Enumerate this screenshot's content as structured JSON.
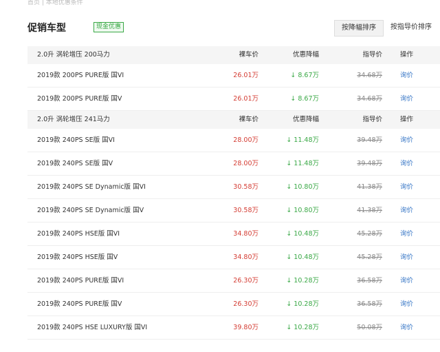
{
  "top_note": "首页 | 本地优惠条件",
  "header": {
    "title": "促销车型",
    "badge": "现金优惠",
    "sort_cut_label": "按降幅排序",
    "sort_guide_label": "按指导价排序"
  },
  "groups": [
    {
      "engine": "2.0升 涡轮增压 200马力",
      "columns": {
        "price": "裸车价",
        "cut": "优惠降幅",
        "guide": "指导价",
        "op": "操作"
      },
      "rows": [
        {
          "name": "2019款 200PS PURE版 国VI",
          "price": "26.01万",
          "cut": "8.67万",
          "guide": "34.68万",
          "op": "询价"
        },
        {
          "name": "2019款 200PS PURE版 国V",
          "price": "26.01万",
          "cut": "8.67万",
          "guide": "34.68万",
          "op": "询价"
        }
      ]
    },
    {
      "engine": "2.0升 涡轮增压 241马力",
      "columns": {
        "price": "裸车价",
        "cut": "优惠降幅",
        "guide": "指导价",
        "op": "操作"
      },
      "rows": [
        {
          "name": "2019款 240PS SE版 国VI",
          "price": "28.00万",
          "cut": "11.48万",
          "guide": "39.48万",
          "op": "询价"
        },
        {
          "name": "2019款 240PS SE版 国V",
          "price": "28.00万",
          "cut": "11.48万",
          "guide": "39.48万",
          "op": "询价"
        },
        {
          "name": "2019款 240PS SE Dynamic版 国VI",
          "price": "30.58万",
          "cut": "10.80万",
          "guide": "41.38万",
          "op": "询价"
        },
        {
          "name": "2019款 240PS SE Dynamic版 国V",
          "price": "30.58万",
          "cut": "10.80万",
          "guide": "41.38万",
          "op": "询价"
        },
        {
          "name": "2019款 240PS HSE版 国VI",
          "price": "34.80万",
          "cut": "10.48万",
          "guide": "45.28万",
          "op": "询价"
        },
        {
          "name": "2019款 240PS HSE版 国V",
          "price": "34.80万",
          "cut": "10.48万",
          "guide": "45.28万",
          "op": "询价"
        },
        {
          "name": "2019款 240PS PURE版 国VI",
          "price": "26.30万",
          "cut": "10.28万",
          "guide": "36.58万",
          "op": "询价"
        },
        {
          "name": "2019款 240PS PURE版 国V",
          "price": "26.30万",
          "cut": "10.28万",
          "guide": "36.58万",
          "op": "询价"
        },
        {
          "name": "2019款 240PS HSE LUXURY版 国VI",
          "price": "39.80万",
          "cut": "10.28万",
          "guide": "50.08万",
          "op": "询价"
        }
      ]
    }
  ],
  "colors": {
    "price": "#d43c33",
    "cut": "#39a845",
    "link": "#3b79c7"
  },
  "icons": {
    "cut_arrow": "down-arrow-icon"
  }
}
